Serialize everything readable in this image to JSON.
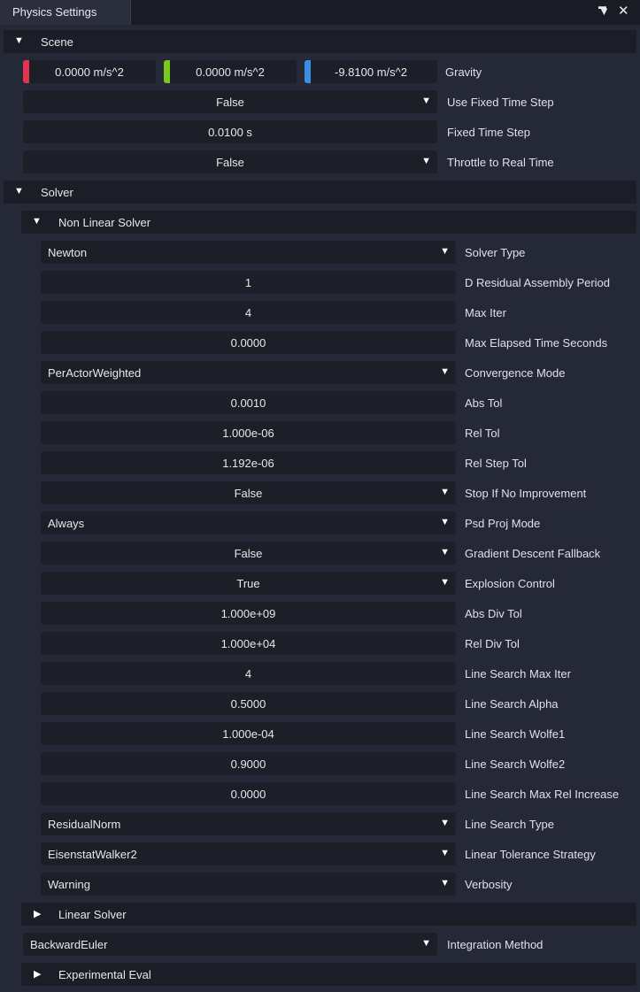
{
  "window": {
    "title": "Physics Settings"
  },
  "scene": {
    "header": "Scene",
    "gravity": {
      "x": "0.0000 m/s^2",
      "y": "0.0000 m/s^2",
      "z": "-9.8100 m/s^2",
      "label": "Gravity",
      "colors": {
        "x": "#e0344f",
        "y": "#79c81b",
        "z": "#3a8ee6"
      }
    },
    "use_fixed_time_step": {
      "value": "False",
      "label": "Use Fixed Time Step"
    },
    "fixed_time_step": {
      "value": "0.0100 s",
      "label": "Fixed Time Step"
    },
    "throttle": {
      "value": "False",
      "label": "Throttle to Real Time"
    }
  },
  "solver": {
    "header": "Solver",
    "nonlinear": {
      "header": "Non Linear Solver",
      "rows": [
        {
          "value": "Newton",
          "label": "Solver Type",
          "type": "dropdown-left"
        },
        {
          "value": "1",
          "label": "D Residual Assembly Period",
          "type": "number"
        },
        {
          "value": "4",
          "label": "Max Iter",
          "type": "number"
        },
        {
          "value": "0.0000",
          "label": "Max Elapsed Time Seconds",
          "type": "number"
        },
        {
          "value": "PerActorWeighted",
          "label": "Convergence Mode",
          "type": "dropdown-left"
        },
        {
          "value": "0.0010",
          "label": "Abs Tol",
          "type": "number"
        },
        {
          "value": "1.000e-06",
          "label": "Rel Tol",
          "type": "number"
        },
        {
          "value": "1.192e-06",
          "label": "Rel Step Tol",
          "type": "number"
        },
        {
          "value": "False",
          "label": "Stop If No Improvement",
          "type": "dropdown-center"
        },
        {
          "value": "Always",
          "label": "Psd Proj Mode",
          "type": "dropdown-left"
        },
        {
          "value": "False",
          "label": "Gradient Descent Fallback",
          "type": "dropdown-center"
        },
        {
          "value": "True",
          "label": "Explosion Control",
          "type": "dropdown-center"
        },
        {
          "value": "1.000e+09",
          "label": "Abs Div Tol",
          "type": "number"
        },
        {
          "value": "1.000e+04",
          "label": "Rel Div Tol",
          "type": "number"
        },
        {
          "value": "4",
          "label": "Line Search Max Iter",
          "type": "number"
        },
        {
          "value": "0.5000",
          "label": "Line Search Alpha",
          "type": "number"
        },
        {
          "value": "1.000e-04",
          "label": "Line Search Wolfe1",
          "type": "number"
        },
        {
          "value": "0.9000",
          "label": "Line Search Wolfe2",
          "type": "number"
        },
        {
          "value": "0.0000",
          "label": "Line Search Max Rel Increase",
          "type": "number"
        },
        {
          "value": "ResidualNorm",
          "label": "Line Search Type",
          "type": "dropdown-left"
        },
        {
          "value": "EisenstatWalker2",
          "label": "Linear Tolerance Strategy",
          "type": "dropdown-left"
        },
        {
          "value": "Warning",
          "label": "Verbosity",
          "type": "dropdown-left"
        }
      ]
    },
    "linear": {
      "header": "Linear Solver"
    },
    "integration": {
      "value": "BackwardEuler",
      "label": "Integration Method"
    },
    "experimental": {
      "header": "Experimental Eval"
    }
  }
}
